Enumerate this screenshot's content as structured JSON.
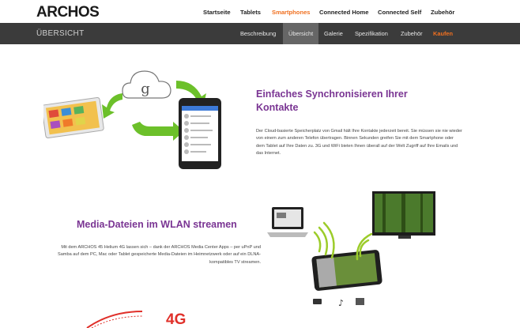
{
  "brand": {
    "logo_text": "ARCHOS"
  },
  "top_nav": {
    "items": [
      {
        "label": "Startseite"
      },
      {
        "label": "Tablets"
      },
      {
        "label": "Smartphones"
      },
      {
        "label": "Connected Home"
      },
      {
        "label": "Connected Self"
      },
      {
        "label": "Zubehör"
      }
    ],
    "active_index": 2
  },
  "sub_nav": {
    "title": "ÜBERSICHT",
    "items": [
      {
        "label": "Beschreibung"
      },
      {
        "label": "Übersicht"
      },
      {
        "label": "Galerie"
      },
      {
        "label": "Spezifikation"
      },
      {
        "label": "Zubehör"
      },
      {
        "label": "Kaufen"
      }
    ],
    "active_index": 1
  },
  "section_sync": {
    "title": "Einfaches Synchronisieren Ihrer Kontakte",
    "body": "Der Cloud-basierte Speicherplatz von Gmail hält Ihre Kontakte jederzeit bereit. Sie müssen sie nie wieder von einem zum anderen Telefon übertragen. Binnen Sekunden greifen Sie mit dem Smartphone oder dem Tablet auf Ihre Daten zu. 3G und WiFi bieten Ihnen überall auf der Welt Zugriff auf Ihre Emails und das Internet.",
    "cloud_letter": "g"
  },
  "section_media": {
    "title": "Media-Dateien im WLAN streamen",
    "body": "Mit dem ARCHOS 45 Helium 4G lassen sich – dank der ARCHOS Media Center Apps – per uPnP und Samba auf dem PC, Mac oder Tablet gespeicherte Media-Dateien im Heimnetzwerk oder auf ein DLNA-kompatibles TV streamen."
  },
  "section_4g": {
    "badge": "4G"
  },
  "colors": {
    "accent": "#f07020",
    "heading": "#7a3593",
    "subnav_bg": "#3b3b3b",
    "arrow_green": "#6cc02a"
  }
}
